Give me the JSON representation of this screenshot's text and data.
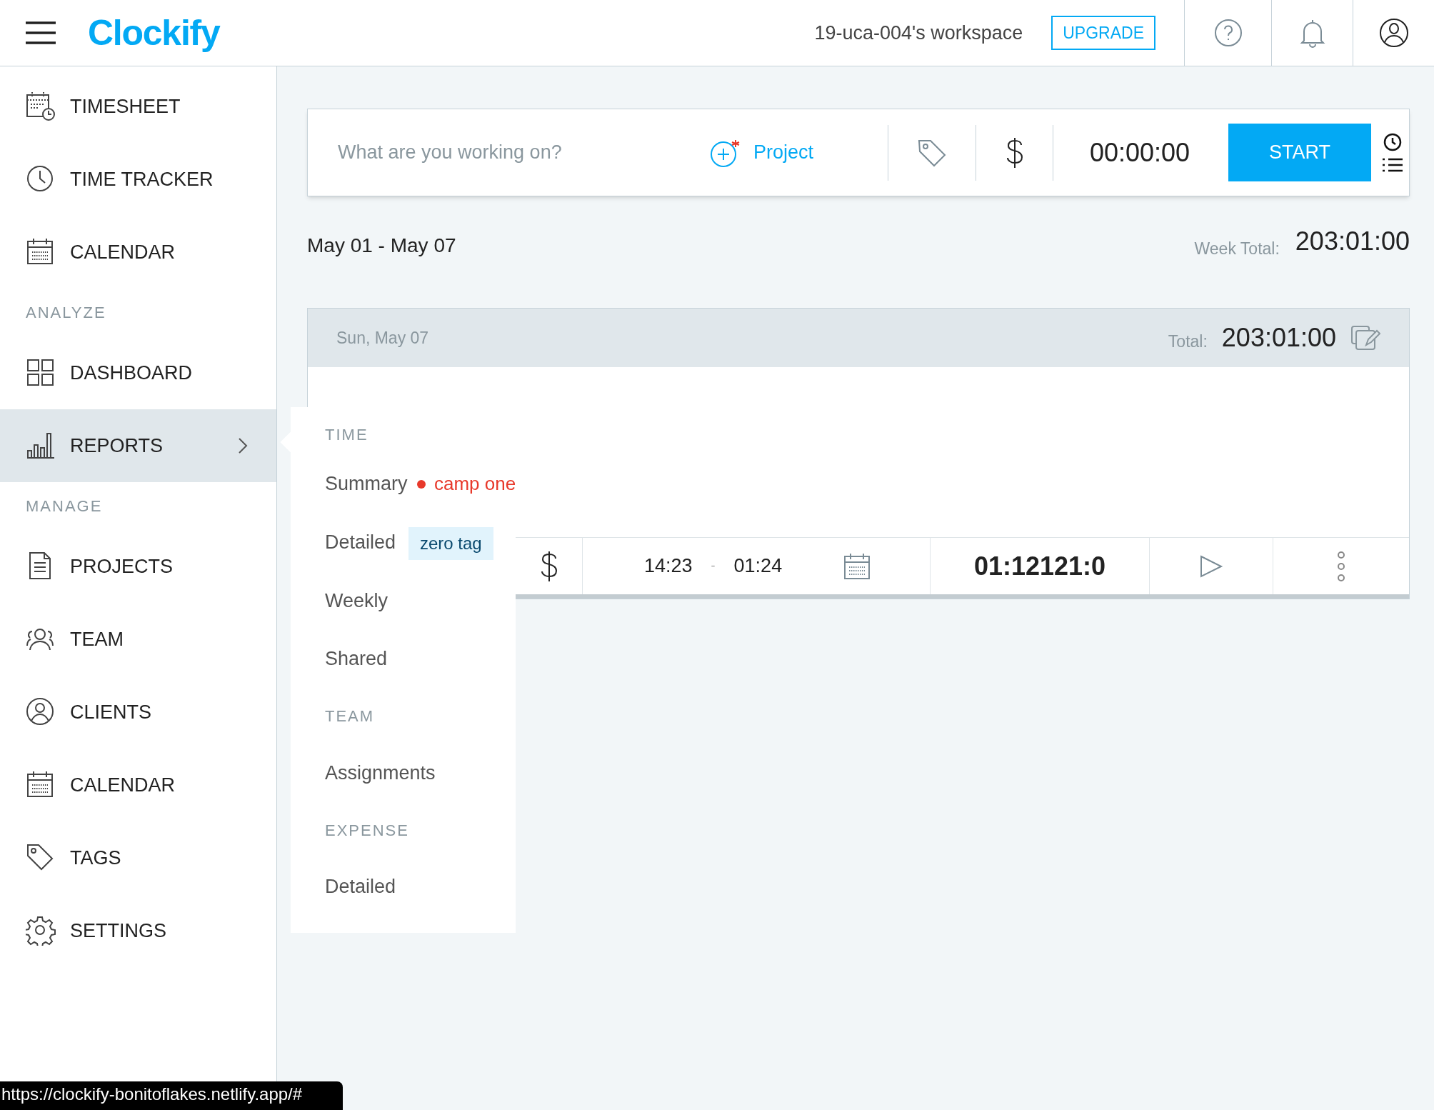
{
  "header": {
    "logo": "Clockify",
    "workspace": "19-uca-004's workspace",
    "upgrade": "UPGRADE"
  },
  "sidebar": {
    "items": [
      {
        "kind": "item",
        "label": "TIMESHEET",
        "selected": false
      },
      {
        "kind": "item",
        "label": "TIME TRACKER",
        "selected": false
      },
      {
        "kind": "item",
        "label": "CALENDAR",
        "selected": false
      },
      {
        "kind": "section",
        "label": "ANALYZE"
      },
      {
        "kind": "item",
        "label": "DASHBOARD",
        "selected": false
      },
      {
        "kind": "item",
        "label": "REPORTS",
        "selected": true
      },
      {
        "kind": "section",
        "label": "MANAGE"
      },
      {
        "kind": "item",
        "label": "PROJECTS",
        "selected": false
      },
      {
        "kind": "item",
        "label": "TEAM",
        "selected": false
      },
      {
        "kind": "item",
        "label": "CLIENTS",
        "selected": false
      },
      {
        "kind": "item",
        "label": "CALENDAR",
        "selected": false
      },
      {
        "kind": "item",
        "label": "TAGS",
        "selected": false
      },
      {
        "kind": "item",
        "label": "SETTINGS",
        "selected": false
      }
    ]
  },
  "timer": {
    "placeholder": "What are you working on?",
    "project": "Project",
    "time": "00:00:00",
    "start": "START"
  },
  "week": {
    "range": "May 01 - May 07",
    "total_label": "Week Total:",
    "total": "203:01:00"
  },
  "day": {
    "date": "Sun, May 07",
    "total_label": "Total:",
    "total": "203:01:00",
    "entry": {
      "project": {
        "name": "camp one",
        "color": "#e8392b"
      },
      "tag": "zero tag",
      "start": "14:23",
      "separator": "-",
      "end": "01:24",
      "duration": "01:12121:0"
    }
  },
  "reports_menu": [
    {
      "kind": "section",
      "label": "TIME"
    },
    {
      "kind": "item",
      "label": "Summary"
    },
    {
      "kind": "item",
      "label": "Detailed"
    },
    {
      "kind": "item",
      "label": "Weekly"
    },
    {
      "kind": "item",
      "label": "Shared"
    },
    {
      "kind": "section",
      "label": "TEAM"
    },
    {
      "kind": "item",
      "label": "Assignments"
    },
    {
      "kind": "section",
      "label": "EXPENSE"
    },
    {
      "kind": "item",
      "label": "Detailed"
    }
  ],
  "status_link": "https://clockify-bonitoflakes.netlify.app/#"
}
